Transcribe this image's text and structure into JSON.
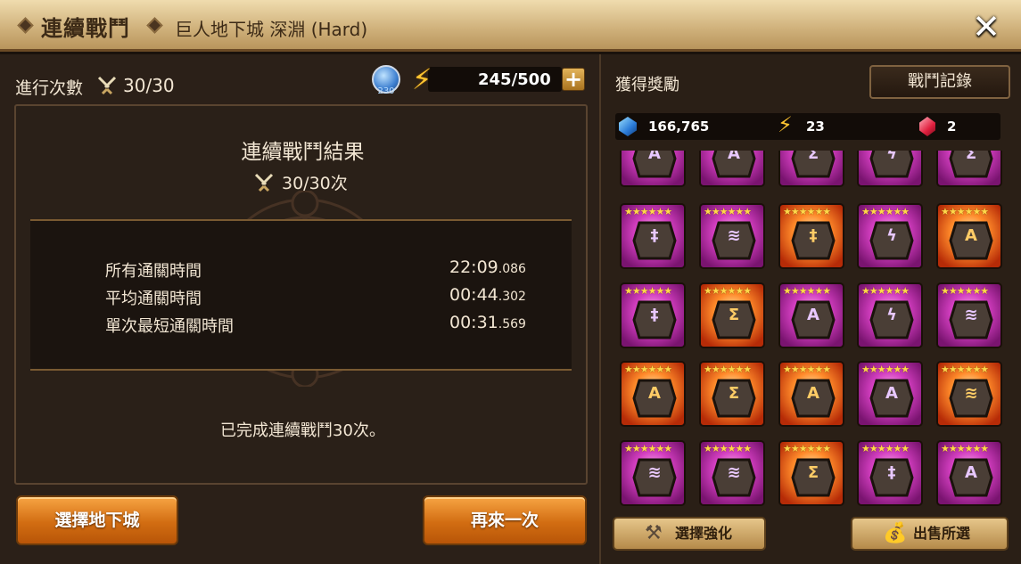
{
  "header": {
    "title": "連續戰鬥",
    "subtitle": "巨人地下城 深淵 (Hard)",
    "close_icon": "close-icon"
  },
  "status": {
    "runs_label": "進行次數",
    "runs_value": "30/30",
    "rank_value": "230",
    "energy_value": "245/500",
    "plus_label": "+"
  },
  "result": {
    "title": "連續戰鬥結果",
    "count": "30/30次",
    "stats": [
      {
        "label": "所有通關時間",
        "value_main": "22:09",
        "value_ms": ".086"
      },
      {
        "label": "平均通關時間",
        "value_main": "00:44",
        "value_ms": ".302"
      },
      {
        "label": "單次最短通關時間",
        "value_main": "00:31",
        "value_ms": ".569"
      }
    ],
    "done": "已完成連續戰鬥30次。"
  },
  "buttons": {
    "select_dungeon": "選擇地下城",
    "retry": "再來一次",
    "select_upgrade": "選擇強化",
    "sell_selected": "出售所選"
  },
  "rewards": {
    "label": "獲得獎勵",
    "log_button": "戰鬥記錄",
    "crystals": "166,765",
    "energy": "23",
    "rune_gems": "2",
    "stars": "★★★★★★",
    "runes": [
      [
        "magenta",
        "A"
      ],
      [
        "magenta",
        "A"
      ],
      [
        "magenta",
        "Σ"
      ],
      [
        "magenta",
        "ϟ"
      ],
      [
        "magenta",
        "Σ"
      ],
      [
        "magenta",
        "‡"
      ],
      [
        "magenta",
        "≋"
      ],
      [
        "orange",
        "‡"
      ],
      [
        "magenta",
        "ϟ"
      ],
      [
        "orange",
        "A"
      ],
      [
        "magenta",
        "‡"
      ],
      [
        "orange",
        "Σ"
      ],
      [
        "magenta",
        "A"
      ],
      [
        "magenta",
        "ϟ"
      ],
      [
        "magenta",
        "≋"
      ],
      [
        "orange",
        "A"
      ],
      [
        "orange",
        "Σ"
      ],
      [
        "orange",
        "A"
      ],
      [
        "magenta",
        "A"
      ],
      [
        "orange",
        "≋"
      ],
      [
        "magenta",
        "≋"
      ],
      [
        "magenta",
        "≋"
      ],
      [
        "orange",
        "Σ"
      ],
      [
        "magenta",
        "‡"
      ],
      [
        "magenta",
        "A"
      ]
    ]
  }
}
